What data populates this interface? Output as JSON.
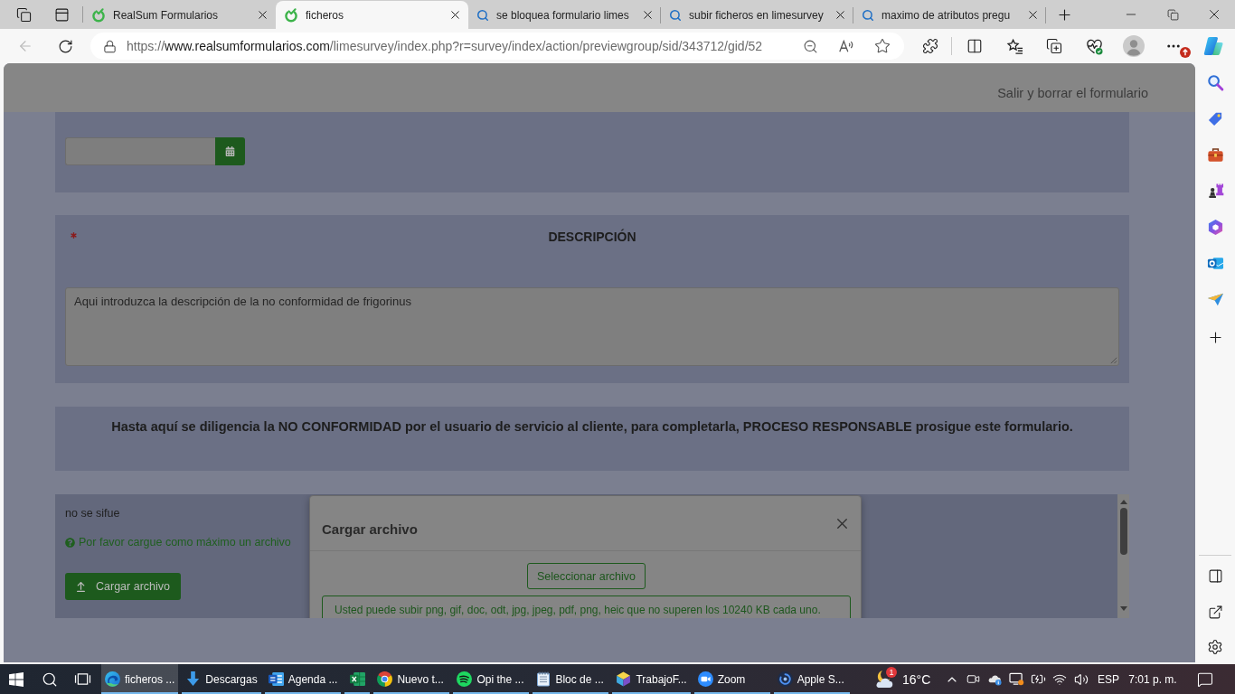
{
  "browser": {
    "tabs": [
      {
        "kind": "site",
        "title": "RealSum Formularios",
        "selected": false
      },
      {
        "kind": "site",
        "title": "ficheros",
        "selected": true
      },
      {
        "kind": "search",
        "title": "se bloquea formulario limes",
        "selected": false
      },
      {
        "kind": "search",
        "title": "subir ficheros en limesurvey",
        "selected": false
      },
      {
        "kind": "search",
        "title": "maximo de atributos pregu",
        "selected": false
      }
    ],
    "back_disabled": true,
    "url": {
      "scheme": "https://",
      "host": "www.realsumformularios.com",
      "path": "/limesurvey/index.php?r=survey/index/action/previewgroup/sid/343712/gid/52"
    }
  },
  "page": {
    "exit_link": "Salir y borrar el formulario",
    "questions": [
      {
        "kind": "date"
      },
      {
        "kind": "long_text",
        "mandatory": true,
        "title": "DESCRIPCIÓN",
        "value": "Aqui introduzca la descripción de la no conformidad de frigorinus"
      },
      {
        "kind": "notice",
        "text": "Hasta aquí se diligencia la NO CONFORMIDAD por el usuario de servicio al cliente, para completarla, PROCESO RESPONSABLE prosigue este formulario."
      },
      {
        "kind": "upload",
        "title": "no se sifue",
        "help": "Por favor cargue como máximo un archivo",
        "button": "Cargar archivo"
      }
    ]
  },
  "modal": {
    "title": "Cargar archivo",
    "select_button": "Seleccionar archivo",
    "info": "Usted puede subir png, gif, doc, odt, jpg, jpeg, pdf, png, heic que no superen los 10240 KB cada uno."
  },
  "taskbar": {
    "apps": [
      {
        "label": "ficheros ...",
        "selected": true
      },
      {
        "label": "Descargas",
        "selected": false
      },
      {
        "label": "Agenda ...",
        "selected": false
      },
      {
        "selected": false
      },
      {
        "label": "Nuevo t...",
        "selected": false
      },
      {
        "label": "Opi the ...",
        "selected": false
      },
      {
        "label": "Bloc de ...",
        "selected": false
      },
      {
        "label": "TrabajoF...",
        "selected": false
      },
      {
        "label": "Zoom",
        "selected": false
      },
      {
        "label": "Apple S...",
        "selected": false
      }
    ],
    "weather": {
      "badge": "1",
      "temperature": "16°C"
    },
    "language": "ESP",
    "time": "7:01 p. m."
  }
}
